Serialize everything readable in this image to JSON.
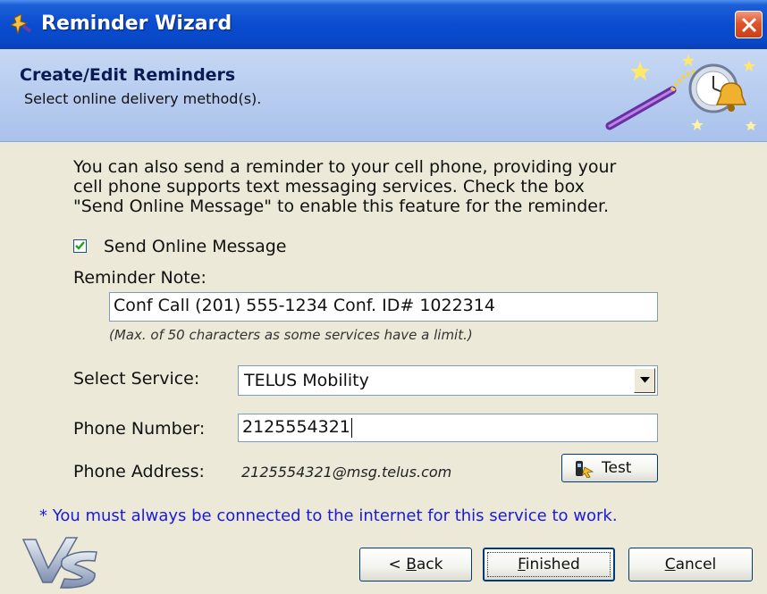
{
  "window": {
    "title": "Reminder Wizard",
    "icons": {
      "app": "wizard-wand-icon",
      "close": "close-icon"
    }
  },
  "header": {
    "title": "Create/Edit Reminders",
    "subtitle": "Select online delivery method(s).",
    "art": "magic-wand-bell-icon"
  },
  "intro_lines": [
    "You can also send a reminder to your cell phone, providing your",
    "cell phone supports text messaging services.  Check the box",
    "\"Send Online Message\" to enable this feature for the reminder."
  ],
  "send_online": {
    "label": "Send Online Message",
    "checked": true
  },
  "reminder_note": {
    "label": "Reminder Note:",
    "value": "Conf Call (201) 555-1234 Conf. ID# 1022314",
    "hint": "(Max. of 50 characters as some services have a limit.)"
  },
  "service": {
    "label": "Select Service:",
    "selected": "TELUS Mobility"
  },
  "phone": {
    "label": "Phone Number:",
    "value": "2125554321"
  },
  "address": {
    "label": "Phone Address:",
    "value": "2125554321@msg.telus.com"
  },
  "test_button": {
    "label": "Test",
    "icon": "phone-test-icon"
  },
  "notice": "* You must always be connected to the internet for this service to work.",
  "buttons": {
    "back": {
      "prefix": "< ",
      "mnemonic": "B",
      "rest": "ack"
    },
    "finished": {
      "mnemonic": "F",
      "rest": "inished"
    },
    "cancel": {
      "mnemonic": "C",
      "rest": "ancel"
    }
  },
  "logo": "vs-logo",
  "colors": {
    "titlebar": "#0a4cd0",
    "header_bg": "#b8cdf0",
    "notice_text": "#1a1adc",
    "dialog_bg": "#ece9d8"
  }
}
